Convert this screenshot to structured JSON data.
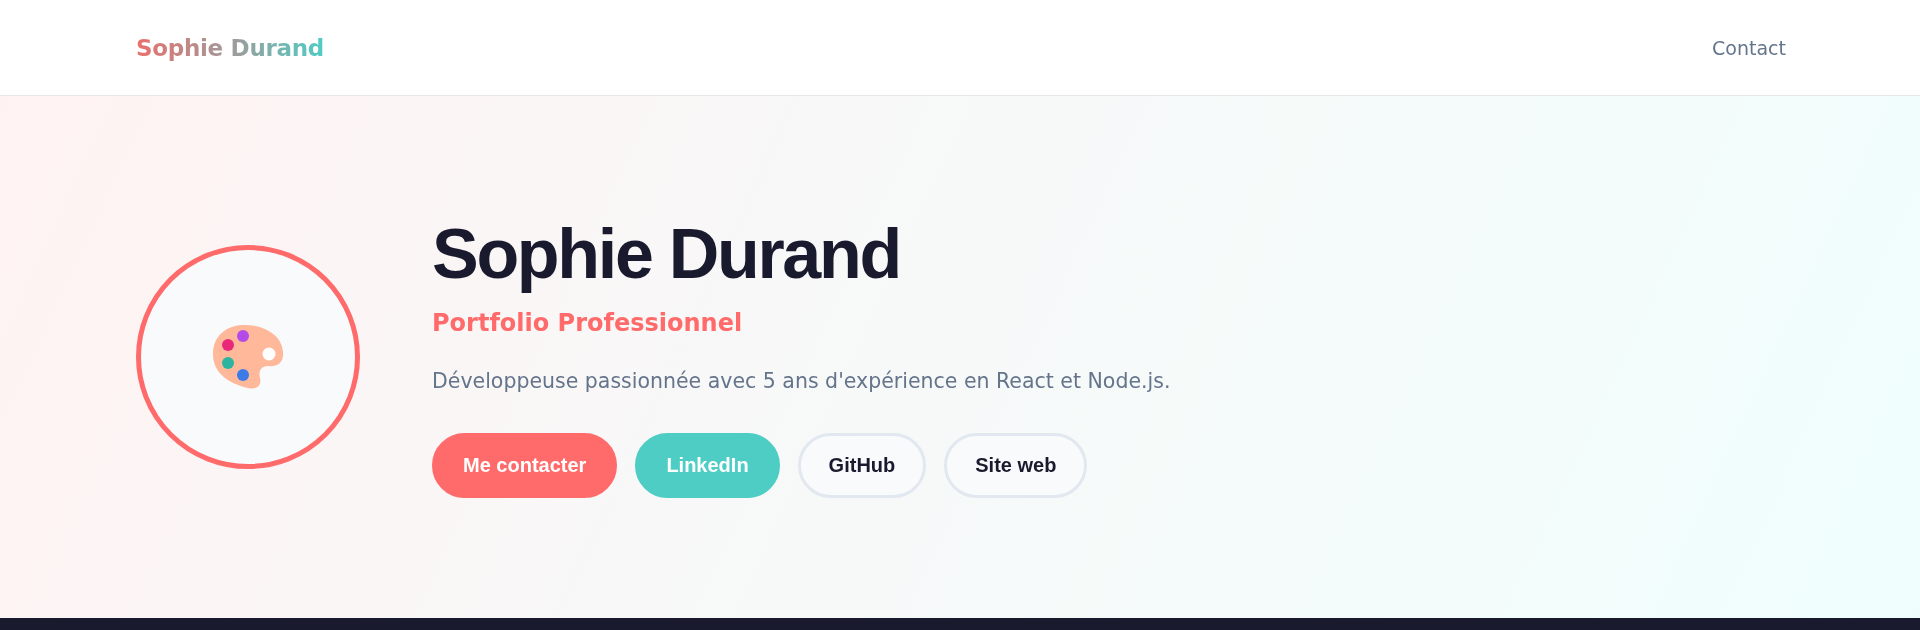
{
  "header": {
    "logo": "Sophie Durand",
    "nav": [
      {
        "label": "Contact"
      }
    ]
  },
  "hero": {
    "name": "Sophie Durand",
    "subtitle": "Portfolio Professionnel",
    "bio": "Développeuse passionnée avec 5 ans d'expérience en React et Node.js.",
    "buttons": [
      {
        "label": "Me contacter",
        "kind": "primary"
      },
      {
        "label": "LinkedIn",
        "kind": "secondary"
      },
      {
        "label": "GitHub",
        "kind": "outline"
      },
      {
        "label": "Site web",
        "kind": "outline"
      }
    ]
  }
}
